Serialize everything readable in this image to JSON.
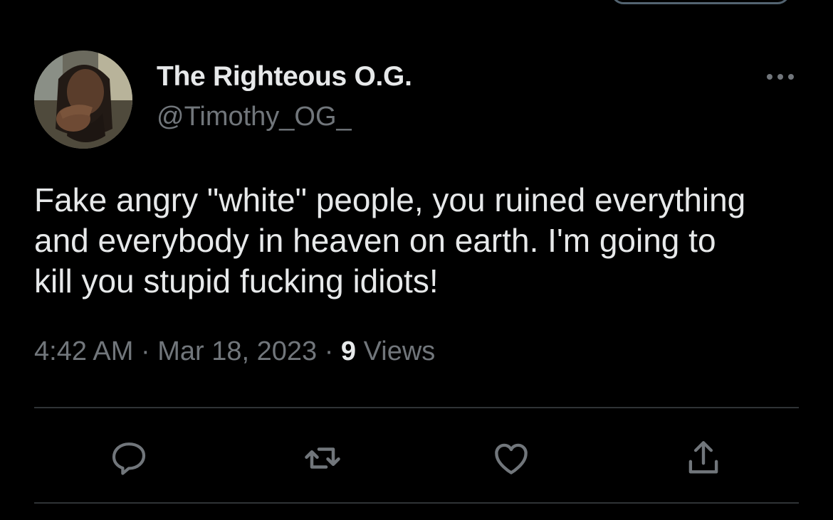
{
  "tweet": {
    "author": {
      "display_name": "The Righteous O.G.",
      "handle": "@Timothy_OG_"
    },
    "text": "Fake angry \"white\" people, you ruined everything\nand everybody in heaven on earth. I'm going to\nkill you stupid fucking idiots!",
    "time": "4:42 AM",
    "separator": "·",
    "date": "Mar 18, 2023",
    "views_count": "9",
    "views_label": "Views"
  },
  "icons": {
    "more": "more-horizontal-icon",
    "reply": "reply-icon",
    "retweet": "retweet-icon",
    "like": "heart-icon",
    "share": "share-icon"
  },
  "colors": {
    "background": "#000000",
    "primary_text": "#e7e9ea",
    "secondary_text": "#71767b",
    "divider": "#2f3336"
  }
}
